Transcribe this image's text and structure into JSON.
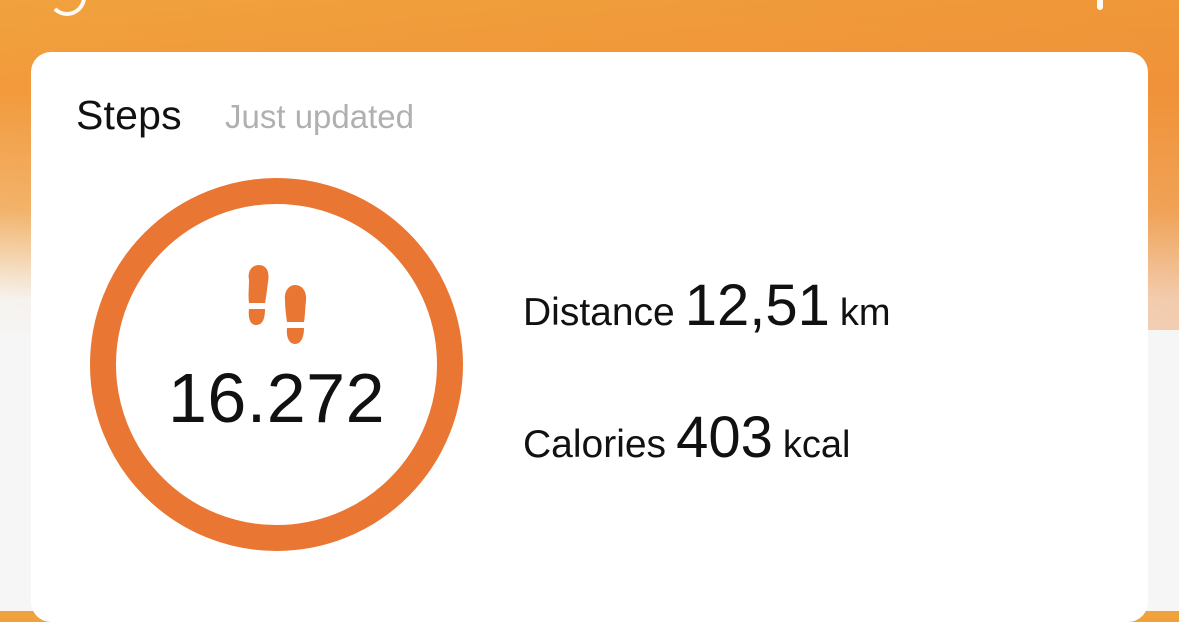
{
  "colors": {
    "accent": "#E97632",
    "header_gradient_start": "#F0A23D",
    "header_gradient_end": "#EE8A35",
    "card_bg": "#FFFFFF",
    "page_bg": "#F6F6F6",
    "subtitle_text": "#B0B0B0",
    "text": "#111111"
  },
  "card": {
    "title": "Steps",
    "subtitle": "Just updated"
  },
  "steps": {
    "icon": "footprints-icon",
    "value": "16.272"
  },
  "stats": [
    {
      "label": "Distance",
      "value": "12,51",
      "unit": "km"
    },
    {
      "label": "Calories",
      "value": "403",
      "unit": "kcal"
    }
  ]
}
